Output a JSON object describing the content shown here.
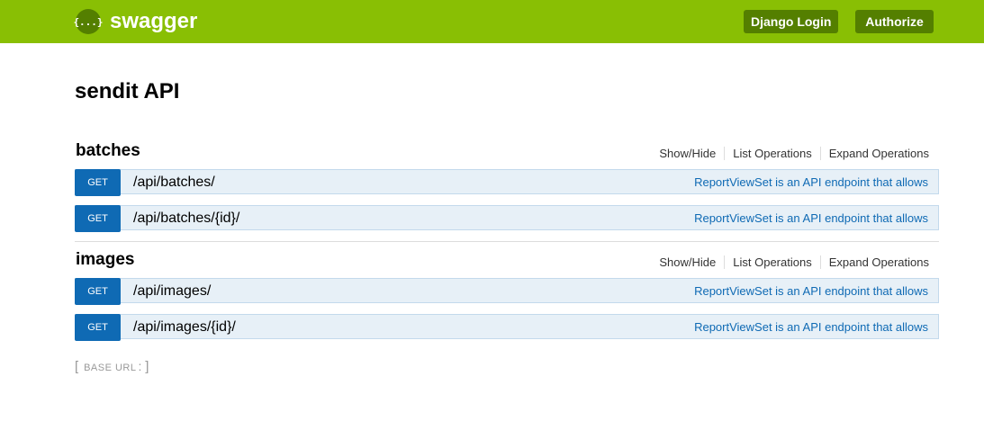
{
  "header": {
    "logo_icon_glyph": "{...}",
    "logo_text": "swagger",
    "login_label": "Django Login",
    "authorize_label": "Authorize",
    "bar_color": "#89bf04",
    "button_color": "#547f00"
  },
  "api_title": "sendit API",
  "resources": [
    {
      "name": "batches",
      "actions": [
        "Show/Hide",
        "List Operations",
        "Expand Operations"
      ],
      "operations": [
        {
          "method": "GET",
          "path": "/api/batches/",
          "summary": "ReportViewSet is an API endpoint that allows"
        },
        {
          "method": "GET",
          "path": "/api/batches/{id}/",
          "summary": "ReportViewSet is an API endpoint that allows"
        }
      ]
    },
    {
      "name": "images",
      "actions": [
        "Show/Hide",
        "List Operations",
        "Expand Operations"
      ],
      "operations": [
        {
          "method": "GET",
          "path": "/api/images/",
          "summary": "ReportViewSet is an API endpoint that allows"
        },
        {
          "method": "GET",
          "path": "/api/images/{id}/",
          "summary": "ReportViewSet is an API endpoint that allows"
        }
      ]
    }
  ],
  "footer": {
    "open_bracket": "[",
    "base_url_label": "base url",
    "colon": ":",
    "base_url_value": "",
    "close_bracket": "]"
  },
  "colors": {
    "get_method": "#0f6ab4",
    "operation_bg": "#e7f0f7",
    "operation_border": "#c3d9ec"
  }
}
